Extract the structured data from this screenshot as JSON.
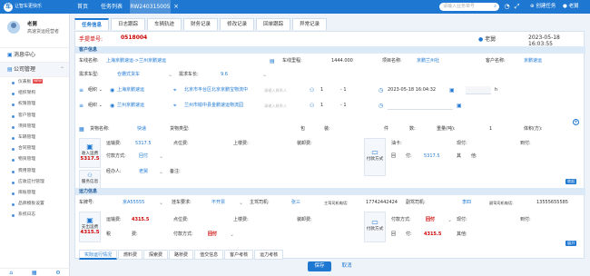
{
  "topbar": {
    "logo_line1": "让智车更快乐",
    "logo_line2": "",
    "logo_mark": "车",
    "nav": [
      "首页",
      "任务列表",
      "RW240315005"
    ],
    "search_placeholder": "请输入业务单号",
    "create_label": "创建任务",
    "user": "老舅"
  },
  "sidebar": {
    "name": "老舅",
    "role": "高速货运经营者",
    "menu": [
      {
        "label": "消息中心"
      },
      {
        "label": "公司管理"
      }
    ],
    "sub": [
      "仪表板",
      "组织架构",
      "权限管理",
      "客户管理",
      "项目管理",
      "车辆管理",
      "合同管理",
      "物资管理",
      "费用管理",
      "应收应付管理",
      "库账管理",
      "品牌模板设置",
      "系统日志"
    ],
    "new_badge": "NEW"
  },
  "tabs": [
    "任务信息",
    "日志跟踪",
    "车辆轨迹",
    "财务记录",
    "修改记录",
    "回单跟踪",
    "异常记录"
  ],
  "order": {
    "label": "手提单号:",
    "no": "0518004",
    "creator": "老舅",
    "time": "2023-05-18 16:03:55"
  },
  "sections": {
    "customer": "客户信息",
    "transport": "运力信息"
  },
  "customer": {
    "row1": {
      "car_no_label": "车线名称:",
      "car_no": "上海京鹏速运->兰州京鹏速运",
      "mileage_label": "车线里程:",
      "mileage": "1444.000",
      "project_label": "项目名称:",
      "project": "京鹏兰州社",
      "customer_label": "客户名称:",
      "customer": "京鹏速运"
    },
    "row2": {
      "vehicle_type_label": "需求车型:",
      "vehicle_type": "仓栅式货车",
      "length_label": "需求车长:",
      "length": "9.6"
    },
    "row3": {
      "tag": "组织",
      "company": "上海京鹏速运",
      "address": "北京市丰台区北京京鹏宝物流中",
      "contact_ph": "请输入联系人",
      "contact_val": "1",
      "time": "2023-05-18 16:04:32",
      "h": "h"
    },
    "row4": {
      "tag": "组织",
      "company": "兰州京鹏速运",
      "address": "兰州市榆中县金鹏速运物流园",
      "contact_ph": "请输入联系人",
      "contact_val": "1"
    },
    "goods": {
      "name_label": "货物名称:",
      "name": "快递",
      "type_label": "货物类型:",
      "pack_label": "包",
      "pack_label2": "装:",
      "piece_label": "件",
      "piece_label2": "数:",
      "weight_label": "重量(吨):",
      "weight": "1",
      "volume_label": "体积(方):"
    },
    "fee": {
      "block_title": "收入运费",
      "block_val": "5317.5",
      "freight_label": "运输费:",
      "freight": "5317.5",
      "pt_label": "点位费:",
      "load_label": "上楼费:",
      "unload_label": "装卸费:",
      "pay_block": "付款方式",
      "card_label": "油卡:",
      "cash_label": "现付:",
      "arrive_label": "到付:",
      "other_label": "其他费:",
      "return_label": "回",
      "return_label2": "付:",
      "return_val": "5317.5",
      "other2_label": "其",
      "other2_label2": "他:",
      "pay_method_label": "付款方式:",
      "pay_method": "回付",
      "keeper_label": "经办人:",
      "keeper": "老舅",
      "remark_label": "备注:",
      "service_block": "服务信息",
      "tag_collapse": "收起"
    }
  },
  "transport": {
    "row1": {
      "plate_label": "车牌号:",
      "plate": "京A55555",
      "trailer_label": "挂车要求:",
      "trailer": "不开票",
      "driver_label": "主驾司机:",
      "driver": "张三",
      "driver_phone_label": "主驾司机电话:",
      "driver_phone": "17742442424",
      "copilot_label": "副驾司机:",
      "copilot": "李四",
      "copilot_phone_label": "副驾司机电话:",
      "copilot_phone": "13555655585"
    },
    "row2": {
      "block": "支出运费",
      "block_val": "4315.5",
      "freight_label": "运输费:",
      "freight": "4315.5",
      "pt_label": "点位费:",
      "load_label": "上楼费:",
      "unload_label": "装卸费:",
      "pay_block": "付款方式",
      "pay_method_label": "付款方式:",
      "pay_method": "回付",
      "cash_label": "现付:",
      "arrive_label": "到付:"
    },
    "row3": {
      "tax_label": "税",
      "tax_label2": "费:",
      "pay2_label": "付款方式:",
      "pay2": "回付",
      "other_label": "其他费:",
      "return_label": "回",
      "return_label2": "付:",
      "return_val": "4315.5",
      "other2_label": "其他:",
      "tag_expand": "展开"
    }
  },
  "bottom_tabs": [
    "实际运行情况",
    "燃料费",
    "探索费",
    "路桥费",
    "值交信息",
    "客户考核",
    "运力考核"
  ],
  "actions": {
    "save": "保存",
    "cancel": "取消"
  }
}
